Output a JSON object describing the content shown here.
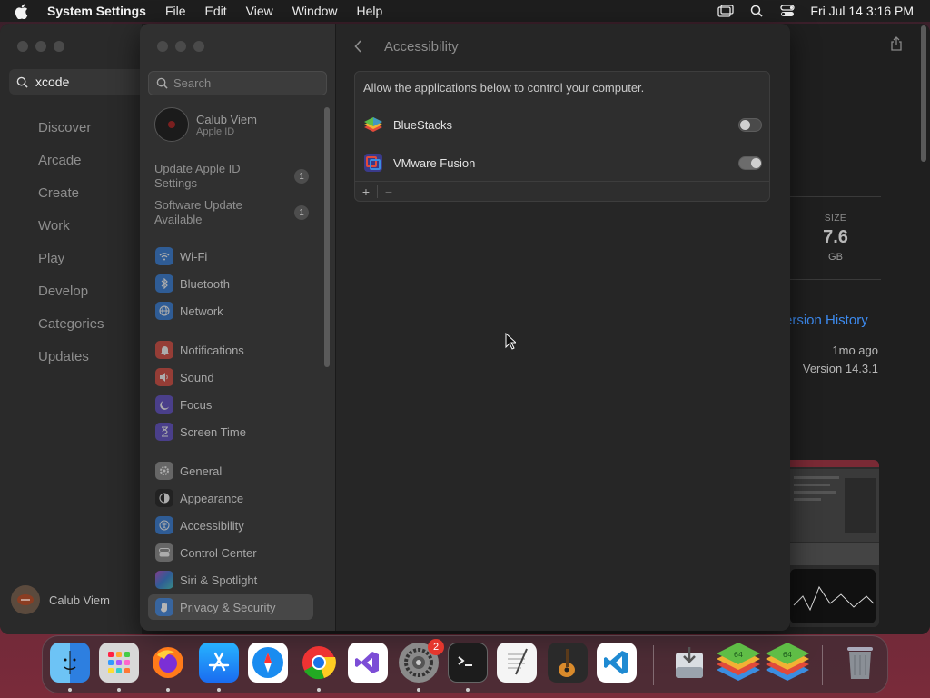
{
  "menubar": {
    "app_name": "System Settings",
    "items": [
      "File",
      "Edit",
      "View",
      "Window",
      "Help"
    ],
    "clock": "Fri Jul 14  3:16 PM",
    "status_icons": [
      "screen-mirroring-icon",
      "spotlight-search-icon",
      "control-center-icon"
    ]
  },
  "appstore": {
    "search_value": "xcode",
    "nav": [
      "Discover",
      "Arcade",
      "Create",
      "Work",
      "Play",
      "Develop",
      "Categories",
      "Updates"
    ],
    "user_name": "Calub Viem",
    "size_label": "SIZE",
    "size_value": "7.6",
    "size_unit": "GB",
    "version_history_link": "ersion History",
    "updated_ago": "1mo ago",
    "version": "Version 14.3.1"
  },
  "settings": {
    "search_placeholder": "Search",
    "account": {
      "name": "Calub Viem",
      "subtitle": "Apple ID"
    },
    "notices": [
      {
        "label": "Update Apple ID Settings",
        "count": "1"
      },
      {
        "label": "Software Update Available",
        "count": "1"
      }
    ],
    "sidebar": [
      {
        "label": "Wi-Fi",
        "icon": "wifi-icon",
        "color": "#2f7ad9"
      },
      {
        "label": "Bluetooth",
        "icon": "bluetooth-icon",
        "color": "#2f7ad9"
      },
      {
        "label": "Network",
        "icon": "network-globe-icon",
        "color": "#2f7ad9"
      },
      {
        "label": "Notifications",
        "icon": "notifications-bell-icon",
        "color": "#d9463b"
      },
      {
        "label": "Sound",
        "icon": "sound-speaker-icon",
        "color": "#d9463b"
      },
      {
        "label": "Focus",
        "icon": "focus-moon-icon",
        "color": "#5c4ac7"
      },
      {
        "label": "Screen Time",
        "icon": "screen-time-hourglass-icon",
        "color": "#5c4ac7"
      },
      {
        "label": "General",
        "icon": "general-gear-icon",
        "color": "#8a8a8a"
      },
      {
        "label": "Appearance",
        "icon": "appearance-icon",
        "color": "#1a1a1a"
      },
      {
        "label": "Accessibility",
        "icon": "accessibility-icon",
        "color": "#2f7ad9"
      },
      {
        "label": "Control Center",
        "icon": "control-center-icon",
        "color": "#8a8a8a"
      },
      {
        "label": "Siri & Spotlight",
        "icon": "siri-icon",
        "color": "#b545c9"
      },
      {
        "label": "Privacy & Security",
        "icon": "privacy-hand-icon",
        "color": "#2f7ad9"
      }
    ],
    "selected_item": "Privacy & Security",
    "page_title": "Accessibility",
    "description": "Allow the applications below to control your computer.",
    "apps": [
      {
        "name": "BlueStacks",
        "icon": "bluestacks-icon",
        "enabled": false
      },
      {
        "name": "VMware Fusion",
        "icon": "vmware-fusion-icon",
        "enabled": true
      }
    ],
    "add_label": "+",
    "remove_label": "−"
  },
  "dock": {
    "apps": [
      {
        "name": "finder-icon",
        "running": true
      },
      {
        "name": "launchpad-icon",
        "running": true
      },
      {
        "name": "firefox-icon",
        "running": true
      },
      {
        "name": "app-store-icon",
        "running": true
      },
      {
        "name": "safari-icon",
        "running": false
      },
      {
        "name": "chrome-icon",
        "running": true
      },
      {
        "name": "visual-studio-icon",
        "running": false
      },
      {
        "name": "system-settings-icon",
        "running": true,
        "badge": "2"
      },
      {
        "name": "terminal-icon",
        "running": true
      },
      {
        "name": "textedit-icon",
        "running": false
      },
      {
        "name": "garageband-icon",
        "running": false
      },
      {
        "name": "vscode-icon",
        "running": false
      },
      {
        "name": "downloads-icon",
        "running": false
      },
      {
        "name": "bluestacks-icon",
        "running": false
      },
      {
        "name": "bluestacks-x-icon",
        "running": false
      },
      {
        "name": "trash-icon",
        "running": false
      }
    ]
  }
}
